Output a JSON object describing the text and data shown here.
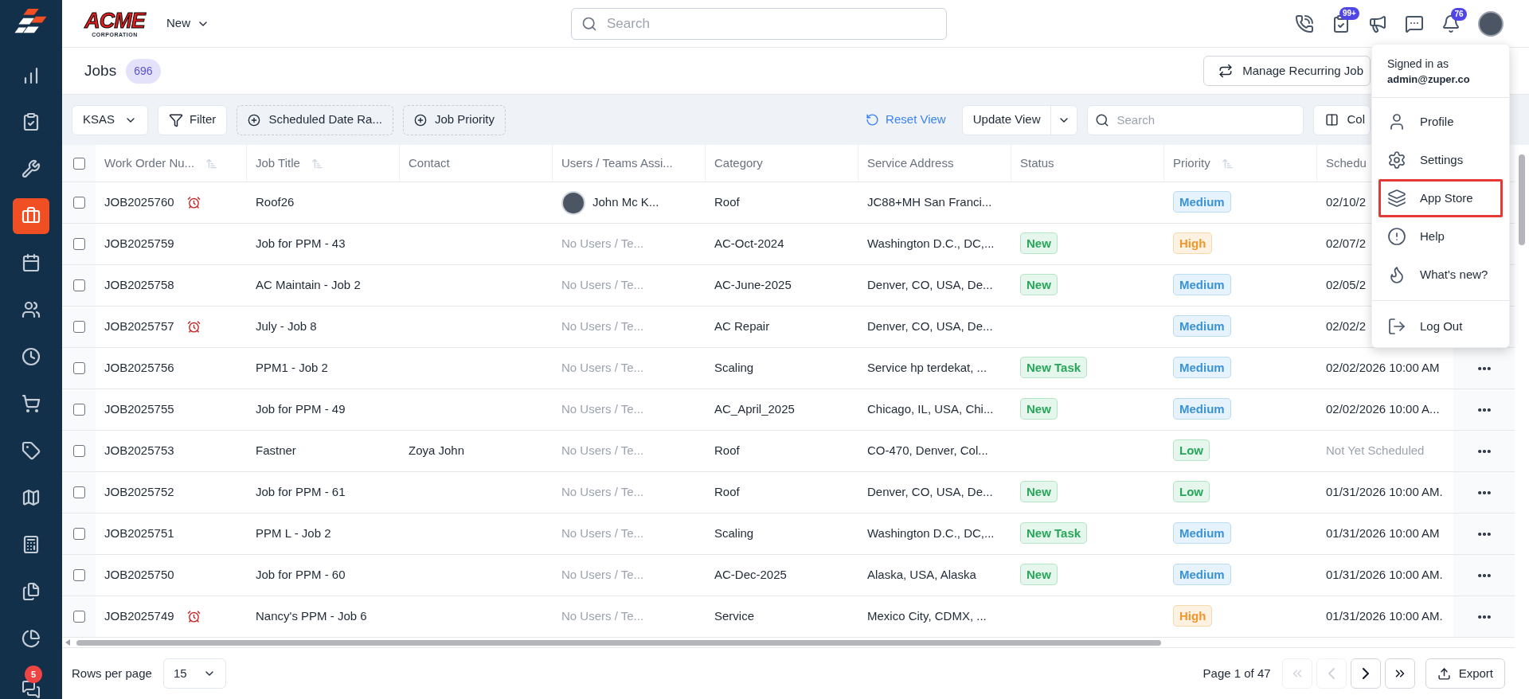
{
  "sidebar": {
    "items": [
      {
        "selected": false
      },
      {
        "selected": false
      },
      {
        "selected": false
      },
      {
        "selected": true
      },
      {
        "selected": false
      },
      {
        "selected": false
      },
      {
        "selected": false
      },
      {
        "selected": false
      },
      {
        "selected": false
      },
      {
        "selected": false
      },
      {
        "selected": false
      },
      {
        "selected": false
      },
      {
        "selected": false
      }
    ],
    "chat_badge": "5"
  },
  "topbar": {
    "logo": {
      "word": "ACME",
      "sub": "CORPORATION"
    },
    "new_menu": "New",
    "search": {
      "placeholder": "Search"
    },
    "task_badge": "99+",
    "bell_badge": "76"
  },
  "header": {
    "title": "Jobs",
    "count": "696",
    "manage_button": "Manage Recurring Job"
  },
  "toolbar": {
    "view": "KSAS",
    "filter": "Filter",
    "chips": [
      "Scheduled Date Ra...",
      "Job Priority"
    ],
    "reset": "Reset View",
    "update": "Update View",
    "search": {
      "placeholder": "Search"
    },
    "columns": "Col"
  },
  "table": {
    "select_all": {
      "checked": false
    },
    "columns": [
      {
        "label": "Work Order Nu...",
        "sortable": true
      },
      {
        "label": "Job Title",
        "sortable": true
      },
      {
        "label": "Contact",
        "sortable": false
      },
      {
        "label": "Users / Teams Assi...",
        "sortable": false
      },
      {
        "label": "Category",
        "sortable": false
      },
      {
        "label": "Service Address",
        "sortable": false
      },
      {
        "label": "Status",
        "sortable": false
      },
      {
        "label": "Priority",
        "sortable": true
      },
      {
        "label": "Schedu",
        "sortable": false
      }
    ],
    "rows": [
      {
        "checked": false,
        "work_order": "JOB2025760",
        "alarm": true,
        "title": "Roof26",
        "contact": "",
        "assignee": {
          "kind": "user",
          "text": "John Mc K..."
        },
        "category": "Roof",
        "address": "JC88+MH San Franci...",
        "status": "",
        "priority": {
          "kind": "medium",
          "text": "Medium"
        },
        "scheduled": {
          "kind": "date",
          "text": "02/10/2"
        },
        "actions": false
      },
      {
        "checked": false,
        "work_order": "JOB2025759",
        "alarm": false,
        "title": "Job for PPM - 43",
        "contact": "",
        "assignee": {
          "kind": "none",
          "text": "No Users / Te..."
        },
        "category": "AC-Oct-2024",
        "address": "Washington D.C., DC,...",
        "status": "New",
        "priority": {
          "kind": "high",
          "text": "High"
        },
        "scheduled": {
          "kind": "date",
          "text": "02/07/2"
        },
        "actions": false
      },
      {
        "checked": false,
        "work_order": "JOB2025758",
        "alarm": false,
        "title": "AC Maintain - Job 2",
        "contact": "",
        "assignee": {
          "kind": "none",
          "text": "No Users / Te..."
        },
        "category": "AC-June-2025",
        "address": "Denver, CO, USA, De...",
        "status": "New",
        "priority": {
          "kind": "medium",
          "text": "Medium"
        },
        "scheduled": {
          "kind": "date",
          "text": "02/05/2"
        },
        "actions": false
      },
      {
        "checked": false,
        "work_order": "JOB2025757",
        "alarm": true,
        "title": "July - Job 8",
        "contact": "",
        "assignee": {
          "kind": "none",
          "text": "No Users / Te..."
        },
        "category": "AC Repair",
        "address": "Denver, CO, USA, De...",
        "status": "",
        "priority": {
          "kind": "medium",
          "text": "Medium"
        },
        "scheduled": {
          "kind": "date",
          "text": "02/02/2"
        },
        "actions": false
      },
      {
        "checked": false,
        "work_order": "JOB2025756",
        "alarm": false,
        "title": "PPM1 - Job 2",
        "contact": "",
        "assignee": {
          "kind": "none",
          "text": "No Users / Te..."
        },
        "category": "Scaling",
        "address": "Service hp terdekat, ...",
        "status": "New Task",
        "priority": {
          "kind": "medium",
          "text": "Medium"
        },
        "scheduled": {
          "kind": "date",
          "text": "02/02/2026 10:00 AM"
        },
        "actions": true
      },
      {
        "checked": false,
        "work_order": "JOB2025755",
        "alarm": false,
        "title": "Job for PPM - 49",
        "contact": "",
        "assignee": {
          "kind": "none",
          "text": "No Users / Te..."
        },
        "category": "AC_April_2025",
        "address": "Chicago, IL, USA, Chi...",
        "status": "New",
        "priority": {
          "kind": "medium",
          "text": "Medium"
        },
        "scheduled": {
          "kind": "date",
          "text": "02/02/2026 10:00 A..."
        },
        "actions": true
      },
      {
        "checked": false,
        "work_order": "JOB2025753",
        "alarm": false,
        "title": "Fastner",
        "contact": "Zoya John",
        "assignee": {
          "kind": "none",
          "text": "No Users / Te..."
        },
        "category": "Roof",
        "address": "CO-470, Denver, Col...",
        "status": "",
        "priority": {
          "kind": "low",
          "text": "Low"
        },
        "scheduled": {
          "kind": "none",
          "text": "Not Yet Scheduled"
        },
        "actions": true
      },
      {
        "checked": false,
        "work_order": "JOB2025752",
        "alarm": false,
        "title": "Job for PPM - 61",
        "contact": "",
        "assignee": {
          "kind": "none",
          "text": "No Users / Te..."
        },
        "category": "Roof",
        "address": "Denver, CO, USA, De...",
        "status": "New",
        "priority": {
          "kind": "low",
          "text": "Low"
        },
        "scheduled": {
          "kind": "date",
          "text": "01/31/2026 10:00 AM."
        },
        "actions": true
      },
      {
        "checked": false,
        "work_order": "JOB2025751",
        "alarm": false,
        "title": "PPM L - Job 2",
        "contact": "",
        "assignee": {
          "kind": "none",
          "text": "No Users / Te..."
        },
        "category": "Scaling",
        "address": "Washington D.C., DC,...",
        "status": "New Task",
        "priority": {
          "kind": "medium",
          "text": "Medium"
        },
        "scheduled": {
          "kind": "date",
          "text": "01/31/2026 10:00 AM"
        },
        "actions": true
      },
      {
        "checked": false,
        "work_order": "JOB2025750",
        "alarm": false,
        "title": "Job for PPM - 60",
        "contact": "",
        "assignee": {
          "kind": "none",
          "text": "No Users / Te..."
        },
        "category": "AC-Dec-2025",
        "address": "Alaska, USA, Alaska",
        "status": "New",
        "priority": {
          "kind": "medium",
          "text": "Medium"
        },
        "scheduled": {
          "kind": "date",
          "text": "01/31/2026 10:00 AM."
        },
        "actions": true
      },
      {
        "checked": false,
        "work_order": "JOB2025749",
        "alarm": true,
        "title": "Nancy's PPM - Job 6",
        "contact": "",
        "assignee": {
          "kind": "none",
          "text": "No Users / Te..."
        },
        "category": "Service",
        "address": "Mexico City, CDMX, ...",
        "status": "",
        "priority": {
          "kind": "high",
          "text": "High"
        },
        "scheduled": {
          "kind": "date",
          "text": "01/31/2026 10:00 AM."
        },
        "actions": true
      }
    ]
  },
  "footer": {
    "rows_label": "Rows per page",
    "rows_value": "15",
    "page": "Page 1 of 47",
    "pager": [
      {
        "disabled": true
      },
      {
        "disabled": true
      },
      {
        "disabled": false
      },
      {
        "disabled": false
      }
    ],
    "export": "Export"
  },
  "user_menu": {
    "signed_in": "Signed in as",
    "email": "admin@zuper.co",
    "items": [
      {
        "label": "Profile",
        "highlighted": false
      },
      {
        "label": "Settings",
        "highlighted": false
      },
      {
        "label": "App Store",
        "highlighted": true
      },
      {
        "label": "Help",
        "highlighted": false
      },
      {
        "label": "What's new?",
        "highlighted": false
      },
      {
        "label": "Log Out",
        "highlighted": false
      }
    ]
  }
}
